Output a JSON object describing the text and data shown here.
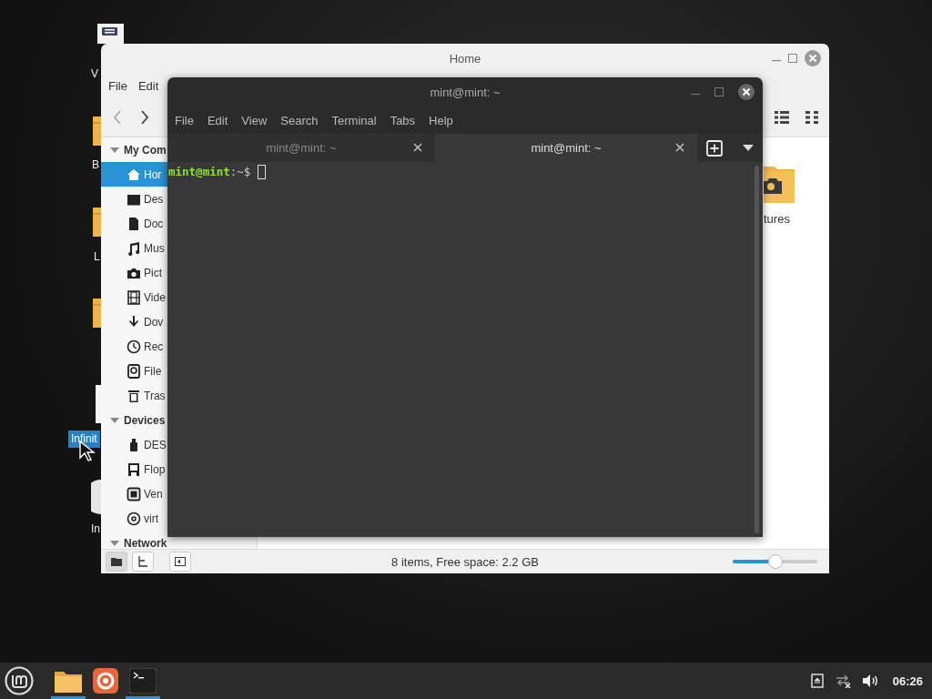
{
  "desktop_icons": [
    {
      "label": "V",
      "selected": false
    },
    {
      "label": "B",
      "selected": false
    },
    {
      "label": "L",
      "selected": false
    },
    {
      "label": "Infinit",
      "selected": true
    },
    {
      "label": "In",
      "selected": false
    }
  ],
  "file_manager": {
    "title": "Home",
    "menu": [
      "File",
      "Edit"
    ],
    "sidebar": [
      {
        "heading": "My Com",
        "expanded": true,
        "items": [
          {
            "label": "Hor",
            "kind": "home",
            "selected": true
          },
          {
            "label": "Des",
            "kind": "desktop",
            "selected": false
          },
          {
            "label": "Doc",
            "kind": "document",
            "selected": false
          },
          {
            "label": "Mus",
            "kind": "music",
            "selected": false
          },
          {
            "label": "Pict",
            "kind": "camera",
            "selected": false
          },
          {
            "label": "Vide",
            "kind": "film",
            "selected": false
          },
          {
            "label": "Dov",
            "kind": "download",
            "selected": false
          },
          {
            "label": "Rec",
            "kind": "clock",
            "selected": false
          },
          {
            "label": "File",
            "kind": "disk",
            "selected": false
          },
          {
            "label": "Tras",
            "kind": "trash",
            "selected": false
          }
        ]
      },
      {
        "heading": "Devices",
        "expanded": true,
        "items": [
          {
            "label": "DES",
            "kind": "usb",
            "selected": false
          },
          {
            "label": "Flop",
            "kind": "floppy",
            "selected": false
          },
          {
            "label": "Ven",
            "kind": "drive",
            "selected": false
          },
          {
            "label": "virt",
            "kind": "disc",
            "selected": false
          }
        ]
      },
      {
        "heading": "Network",
        "expanded": true
      }
    ],
    "items": [
      {
        "label": "tures"
      }
    ],
    "status": "8 items, Free space: 2.2 GB",
    "zoom": {
      "level": 0.5
    }
  },
  "terminal": {
    "title": "mint@mint: ~",
    "menu": [
      "File",
      "Edit",
      "View",
      "Search",
      "Terminal",
      "Tabs",
      "Help"
    ],
    "tabs": [
      {
        "label": "mint@mint: ~",
        "selected": false
      },
      {
        "label": "mint@mint: ~",
        "selected": true
      }
    ],
    "prompt": {
      "user": "mint@mint",
      "path": ":~$"
    }
  },
  "taskbar": {
    "apps": [
      {
        "kind": "files",
        "running": true
      },
      {
        "kind": "browser",
        "running": false
      },
      {
        "kind": "terminal",
        "running": true
      }
    ],
    "clock": "06:26"
  }
}
